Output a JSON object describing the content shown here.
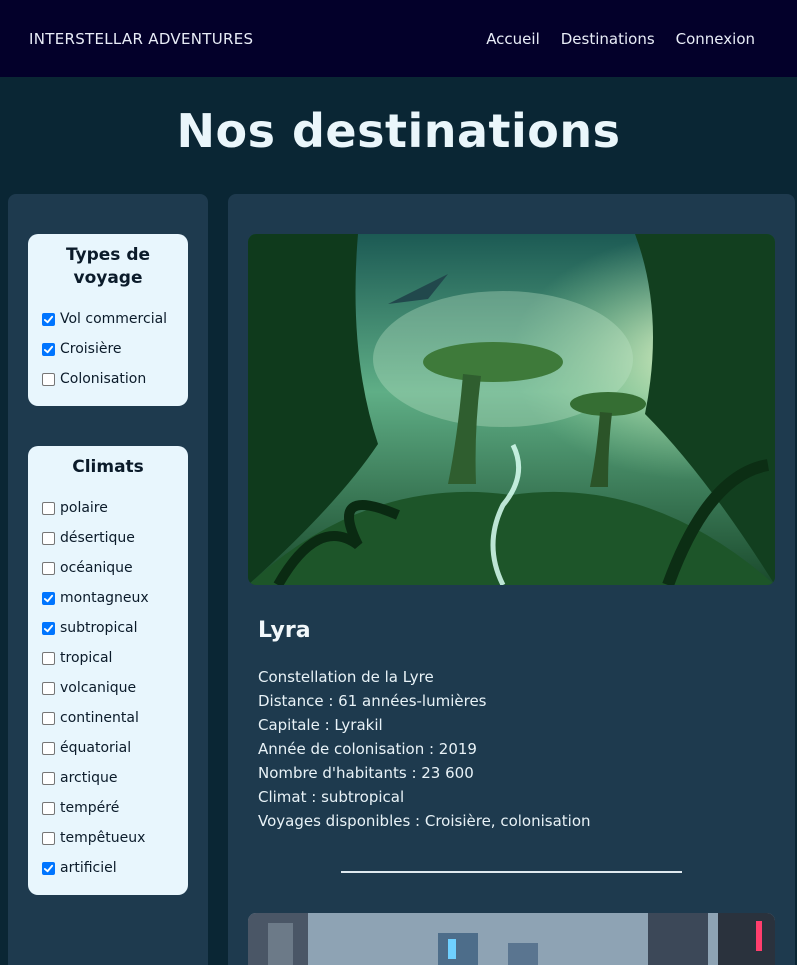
{
  "header": {
    "brand": "INTERSTELLAR ADVENTURES",
    "nav": [
      "Accueil",
      "Destinations",
      "Connexion"
    ]
  },
  "page_title": "Nos destinations",
  "filters": {
    "travel_types": {
      "title": "Types de voyage",
      "options": [
        {
          "label": "Vol commercial",
          "checked": true
        },
        {
          "label": "Croisière",
          "checked": true
        },
        {
          "label": "Colonisation",
          "checked": false
        }
      ]
    },
    "climates": {
      "title": "Climats",
      "options": [
        {
          "label": "polaire",
          "checked": false
        },
        {
          "label": "désertique",
          "checked": false
        },
        {
          "label": "océanique",
          "checked": false
        },
        {
          "label": "montagneux",
          "checked": true
        },
        {
          "label": "subtropical",
          "checked": true
        },
        {
          "label": "tropical",
          "checked": false
        },
        {
          "label": "volcanique",
          "checked": false
        },
        {
          "label": "continental",
          "checked": false
        },
        {
          "label": "équatorial",
          "checked": false
        },
        {
          "label": "arctique",
          "checked": false
        },
        {
          "label": "tempéré",
          "checked": false
        },
        {
          "label": "tempêtueux",
          "checked": false
        },
        {
          "label": "artificiel",
          "checked": true
        }
      ]
    }
  },
  "destination": {
    "name": "Lyra",
    "constellation": "Constellation de la Lyre",
    "distance": "Distance : 61 années-lumières",
    "capital": "Capitale : Lyrakil",
    "colonization_year": "Année de colonisation : 2019",
    "population": "Nombre d'habitants : 23 600",
    "climate": "Climat : subtropical",
    "trips": "Voyages disponibles : Croisière,  colonisation"
  },
  "colors": {
    "header_bg": "#03002a",
    "page_bg": "#0a2634",
    "panel_bg": "#1e3a4e",
    "filter_bg": "#e8f6fd",
    "checkbox_accent": "#0075ff"
  },
  "icons": {
    "checkbox_checked": "checkmark-icon"
  }
}
